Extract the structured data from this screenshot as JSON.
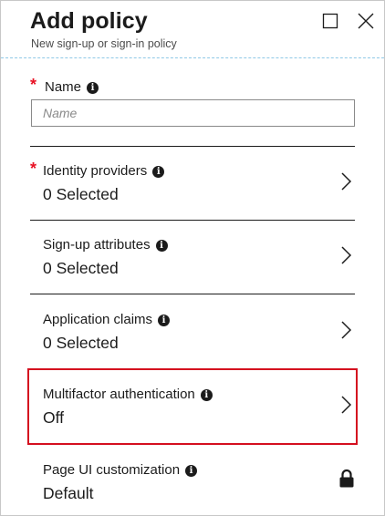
{
  "header": {
    "title": "Add policy",
    "subtitle": "New sign-up or sign-in policy"
  },
  "name_field": {
    "label": "Name",
    "required": true,
    "placeholder": "Name",
    "value": ""
  },
  "rows": [
    {
      "label": "Identity providers",
      "value": "0 Selected",
      "required": true,
      "trailing_icon": "chevron-right-icon"
    },
    {
      "label": "Sign-up attributes",
      "value": "0 Selected",
      "required": false,
      "trailing_icon": "chevron-right-icon"
    },
    {
      "label": "Application claims",
      "value": "0 Selected",
      "required": false,
      "trailing_icon": "chevron-right-icon"
    },
    {
      "label": "Multifactor authentication",
      "value": "Off",
      "required": false,
      "trailing_icon": "chevron-right-icon",
      "highlighted": true
    },
    {
      "label": "Page UI customization",
      "value": "Default",
      "required": false,
      "trailing_icon": "lock-icon"
    }
  ],
  "required_marker": "*",
  "info_glyph": "i",
  "colors": {
    "required": "#e81123",
    "highlight_border": "#d40f1f",
    "header_divider": "#8fc9e6",
    "text": "#1b1b1b"
  },
  "icons": [
    "maximize-icon",
    "close-icon",
    "info-icon",
    "chevron-right-icon",
    "lock-icon"
  ]
}
